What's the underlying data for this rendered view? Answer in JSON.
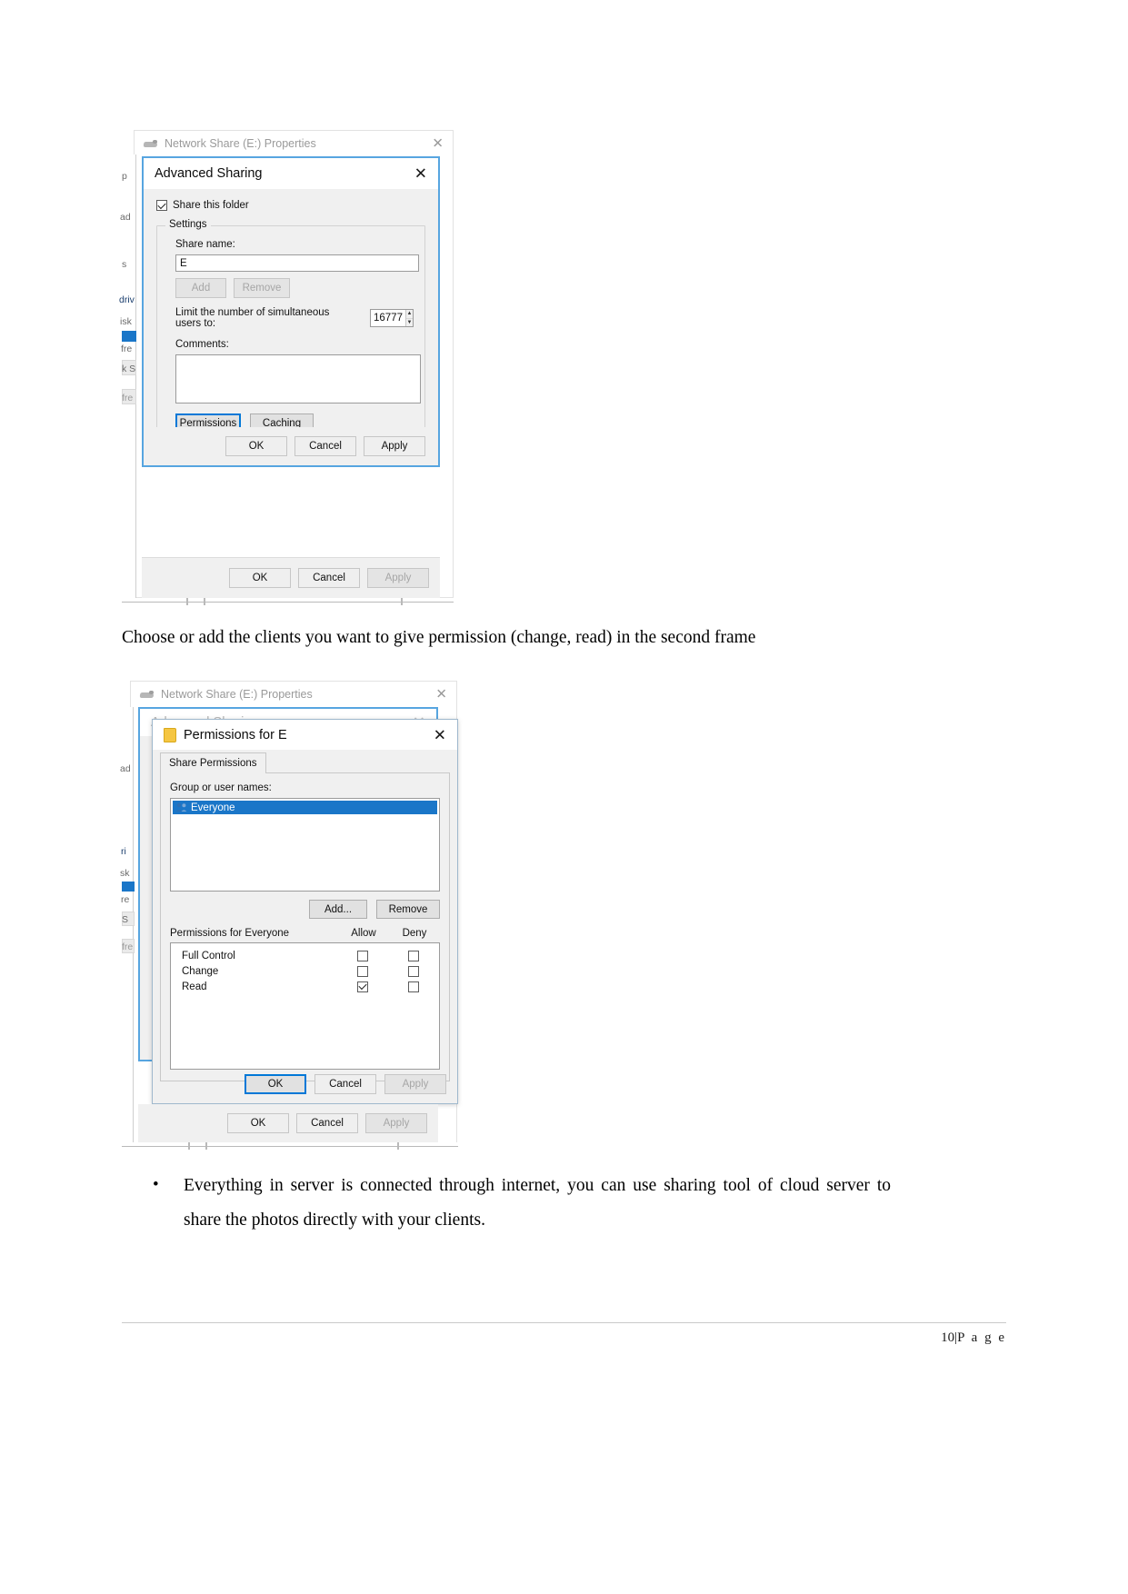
{
  "figure1": {
    "outer_window": {
      "title": "Network Share (E:) Properties",
      "close_icon": "✕",
      "drive_icon": "network-drive-icon",
      "buttons": {
        "ok": "OK",
        "cancel": "Cancel",
        "apply": "Apply"
      }
    },
    "dialog": {
      "title": "Advanced Sharing",
      "close_icon": "✕",
      "share_checkbox_label": "Share this folder",
      "share_checkbox_checked": true,
      "settings_legend": "Settings",
      "share_name_label": "Share name:",
      "share_name_value": "E",
      "add_button": "Add",
      "remove_button": "Remove",
      "limit_label": "Limit the number of simultaneous users to:",
      "limit_value": "16777",
      "comments_label": "Comments:",
      "comments_value": "",
      "permissions_button": "Permissions",
      "caching_button": "Caching",
      "ok_button": "OK",
      "cancel_button": "Cancel",
      "apply_button": "Apply"
    },
    "background_labels": [
      "p",
      "ad",
      "s",
      "driv",
      "isk",
      "fre",
      "k S",
      "fre"
    ]
  },
  "caption1": "Choose or add the clients you want to give permission (change, read) in the second frame",
  "figure2": {
    "outer_window": {
      "title": "Network Share (E:) Properties",
      "close_icon": "✕",
      "drive_icon": "network-drive-icon",
      "buttons": {
        "ok": "OK",
        "cancel": "Cancel",
        "apply": "Apply"
      }
    },
    "middle_dialog": {
      "title": "Advanced Sharing"
    },
    "dialog": {
      "title": "Permissions for E",
      "folder_icon": "folder-icon",
      "close_icon": "✕",
      "tab_label": "Share Permissions",
      "group_label": "Group or user names:",
      "users": [
        {
          "name": "Everyone",
          "icon": "users-group-icon",
          "selected": true
        }
      ],
      "add_button": "Add...",
      "remove_button": "Remove",
      "perm_table_title": "Permissions for Everyone",
      "col_allow": "Allow",
      "col_deny": "Deny",
      "rows": [
        {
          "label": "Full Control",
          "allow": false,
          "deny": false
        },
        {
          "label": "Change",
          "allow": false,
          "deny": false
        },
        {
          "label": "Read",
          "allow": true,
          "deny": false
        }
      ],
      "ok_button": "OK",
      "cancel_button": "Cancel",
      "apply_button": "Apply"
    },
    "background_labels": [
      "ad",
      "ri",
      "sk",
      "re",
      "S",
      "fre"
    ]
  },
  "bullet1": {
    "marker": "•",
    "text": "Everything in server is connected through internet, you can use sharing tool of cloud server  to share the photos directly with your clients."
  },
  "footer": {
    "page_number": "10",
    "separator": "|",
    "page_word": "P a g e"
  },
  "colors": {
    "accent_blue": "#0078d7",
    "selection_blue": "#1a76c8",
    "window_gray": "#f0f0f0",
    "border_gray": "#9b9b9b"
  }
}
